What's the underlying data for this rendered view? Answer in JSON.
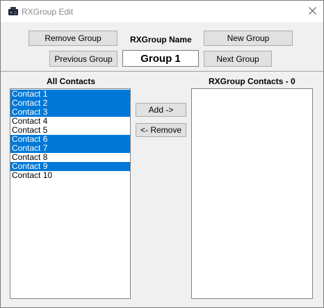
{
  "window": {
    "title": "RXGroup Edit"
  },
  "header": {
    "remove_group_label": "Remove Group",
    "group_name_label": "RXGroup Name",
    "new_group_label": "New Group",
    "previous_group_label": "Previous Group",
    "group_name_value": "Group 1",
    "next_group_label": "Next Group"
  },
  "all_contacts": {
    "heading": "All Contacts",
    "items": [
      {
        "label": "Contact 1",
        "selected": true
      },
      {
        "label": "Contact 2",
        "selected": true
      },
      {
        "label": "Contact 3",
        "selected": true
      },
      {
        "label": "Contact 4",
        "selected": false
      },
      {
        "label": "Contact 5",
        "selected": false
      },
      {
        "label": "Contact 6",
        "selected": true
      },
      {
        "label": "Contact 7",
        "selected": true
      },
      {
        "label": "Contact 8",
        "selected": false
      },
      {
        "label": "Contact 9",
        "selected": true
      },
      {
        "label": "Contact 10",
        "selected": false
      }
    ]
  },
  "actions": {
    "add_label": "Add ->",
    "remove_label": "<- Remove"
  },
  "group_contacts": {
    "heading": "RXGroup Contacts - 0",
    "items": []
  },
  "colors": {
    "selection": "#0078d7",
    "window_bg": "#f0f0f0",
    "button_bg": "#e1e1e1"
  }
}
